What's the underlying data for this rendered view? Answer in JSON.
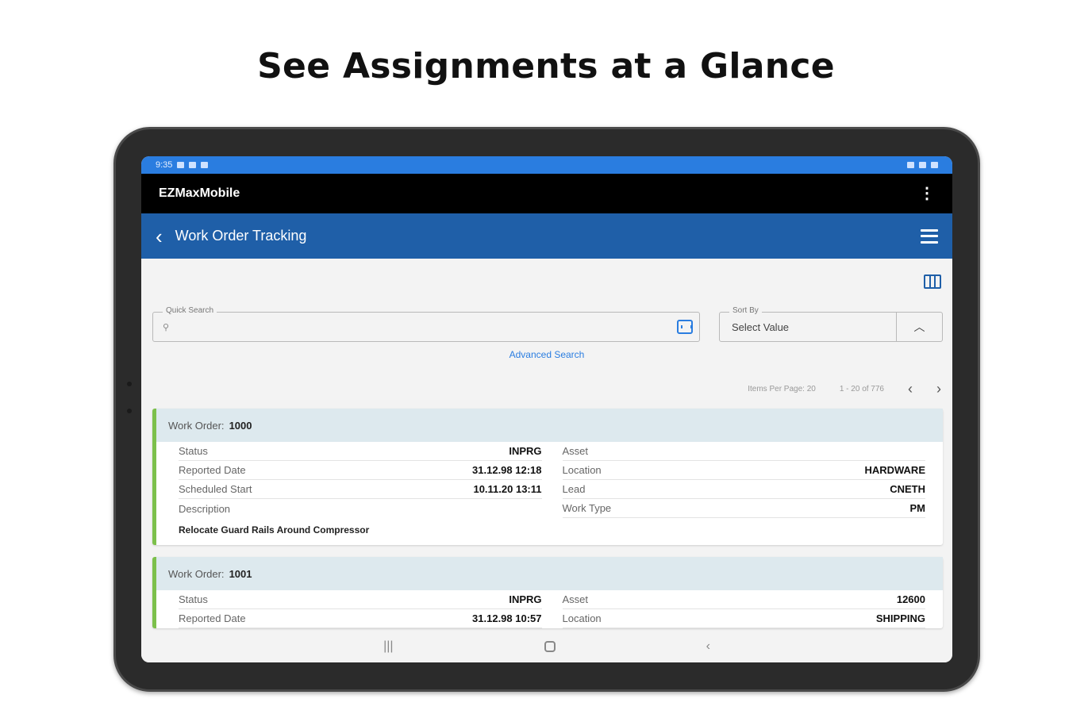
{
  "headline": "See Assignments at a Glance",
  "status_bar": {
    "time": "9:35"
  },
  "app": {
    "title": "EZMaxMobile"
  },
  "nav": {
    "title": "Work Order Tracking"
  },
  "search": {
    "legend": "Quick Search",
    "placeholder": ""
  },
  "sort": {
    "legend": "Sort By",
    "value": "Select Value"
  },
  "advanced_search": "Advanced Search",
  "pager": {
    "items_per_page": "Items Per Page: 20",
    "range": "1 - 20 of 776"
  },
  "work_orders": [
    {
      "label": "Work Order:",
      "number": "1000",
      "left": [
        {
          "k": "Status",
          "v": "INPRG"
        },
        {
          "k": "Reported Date",
          "v": "31.12.98 12:18"
        },
        {
          "k": "Scheduled Start",
          "v": "10.11.20 13:11"
        },
        {
          "k": "Description",
          "v": ""
        }
      ],
      "right": [
        {
          "k": "Asset",
          "v": ""
        },
        {
          "k": "Location",
          "v": "HARDWARE"
        },
        {
          "k": "Lead",
          "v": "CNETH"
        },
        {
          "k": "Work Type",
          "v": "PM"
        }
      ],
      "description": "Relocate Guard Rails Around Compressor"
    },
    {
      "label": "Work Order:",
      "number": "1001",
      "left": [
        {
          "k": "Status",
          "v": "INPRG"
        },
        {
          "k": "Reported Date",
          "v": "31.12.98 10:57"
        }
      ],
      "right": [
        {
          "k": "Asset",
          "v": "12600"
        },
        {
          "k": "Location",
          "v": "SHIPPING"
        }
      ]
    }
  ],
  "colors": {
    "accent": "#1f5fa8",
    "statusbar": "#2a7de0",
    "card_border": "#7cc04b",
    "card_header": "#dde9ee"
  }
}
